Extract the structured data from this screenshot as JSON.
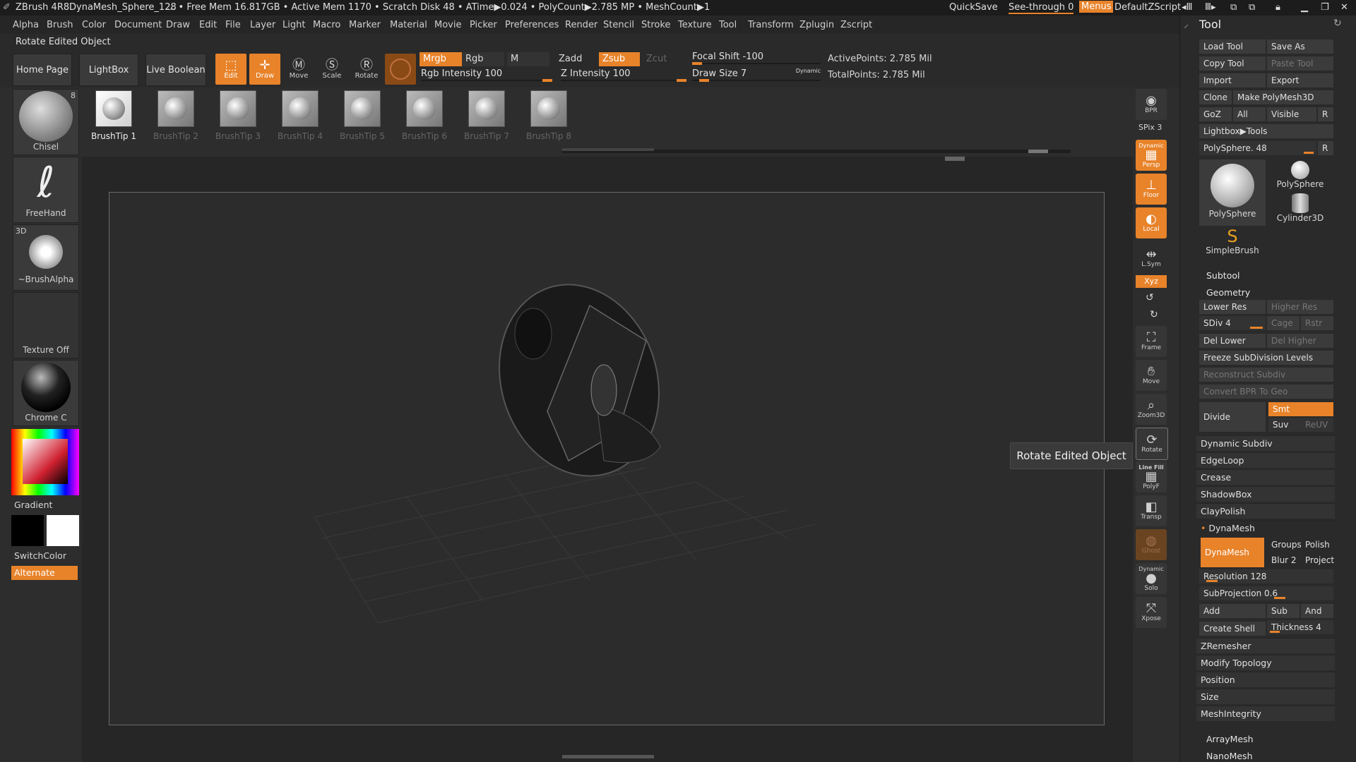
{
  "titlebar": {
    "app": "ZBrush 4R8",
    "doc": "DynaMesh_Sphere_128",
    "stats": "... • Free Mem 16.817GB • Active Mem 1170 • Scratch Disk 48 •  ATime▶0.024 • PolyCount▶2.785 MP  • MeshCount▶1",
    "quicksave": "QuickSave",
    "seethrough": "See-through   0",
    "menus": "Menus",
    "script": "DefaultZScript"
  },
  "menus": [
    "Alpha",
    "Brush",
    "Color",
    "Document",
    "Draw",
    "Edit",
    "File",
    "Layer",
    "Light",
    "Macro",
    "Marker",
    "Material",
    "Movie",
    "Picker",
    "Preferences",
    "Render",
    "Stencil",
    "Stroke",
    "Texture",
    "Tool",
    "Transform",
    "Zplugin",
    "Zscript"
  ],
  "status_text": "Rotate Edited Object",
  "toolbar": {
    "home": "Home Page",
    "lightbox": "LightBox",
    "liveboolean": "Live Boolean",
    "edit": "Edit",
    "draw": "Draw",
    "move": "Move",
    "scale": "Scale",
    "rotate": "Rotate",
    "mrgb": "Mrgb",
    "rgb": "Rgb",
    "m": "M",
    "zadd": "Zadd",
    "zsub": "Zsub",
    "zcut": "Zcut",
    "rgb_intensity": "Rgb Intensity 100",
    "z_intensity": "Z Intensity 100",
    "focal_shift": "Focal Shift -100",
    "draw_size": "Draw Size 7",
    "dynamic": "Dynamic",
    "active_points": "ActivePoints: 2.785 Mil",
    "total_points": "TotalPoints: 2.785 Mil"
  },
  "brushtips": [
    "BrushTip 1",
    "BrushTip 2",
    "BrushTip 3",
    "BrushTip 4",
    "BrushTip 5",
    "BrushTip 6",
    "BrushTip 7",
    "BrushTip 8"
  ],
  "left": {
    "brush": "Chisel",
    "brush_count": "8",
    "stroke": "FreeHand",
    "alpha_tag": "3D",
    "alpha": "~BrushAlpha",
    "texture": "Texture Off",
    "material": "Chrome C",
    "gradient": "Gradient",
    "switchcolor": "SwitchColor",
    "alternate": "Alternate"
  },
  "shelf": {
    "bpr": "BPR",
    "spix": "SPix 3",
    "dynamic": "Dynamic",
    "persp": "Persp",
    "floor": "Floor",
    "local": "Local",
    "lsym": "L.Sym",
    "xyz": "Xyz",
    "frame": "Frame",
    "move": "Move",
    "zoom": "Zoom3D",
    "rotate": "Rotate",
    "linefill": "Line Fill",
    "polyf": "PolyF",
    "transp": "Transp",
    "ghost": "Ghost",
    "dynamic2": "Dynamic",
    "solo": "Solo",
    "xpose": "Xpose"
  },
  "tooltip": "Rotate Edited Object",
  "tool": {
    "title": "Tool",
    "load": "Load Tool",
    "saveas": "Save As",
    "copy": "Copy Tool",
    "paste": "Paste Tool",
    "import": "Import",
    "export": "Export",
    "clone": "Clone",
    "make": "Make PolyMesh3D",
    "goz": "GoZ",
    "all": "All",
    "visible": "Visible",
    "r": "R",
    "lightbox": "Lightbox▶Tools",
    "polysphere_slider": "PolySphere. 48",
    "thumb1": "PolySphere",
    "thumb2": "PolySphere",
    "thumb3": "Cylinder3D",
    "thumb4": "SimpleBrush",
    "subtool": "Subtool",
    "geometry": "Geometry",
    "lower": "Lower Res",
    "higher": "Higher Res",
    "sdiv": "SDiv 4",
    "cage": "Cage",
    "rstr": "Rstr",
    "dellower": "Del Lower",
    "delhigher": "Del Higher",
    "freeze": "Freeze SubDivision Levels",
    "reconstruct": "Reconstruct Subdiv",
    "convert": "Convert BPR To Geo",
    "divide": "Divide",
    "smt": "Smt",
    "suv": "Suv",
    "reuv": "ReUV",
    "dynsubdiv": "Dynamic Subdiv",
    "edgeloop": "EdgeLoop",
    "crease": "Crease",
    "shadowbox": "ShadowBox",
    "claypolish": "ClayPolish",
    "dynamesh_head": "DynaMesh",
    "dynamesh_btn": "DynaMesh",
    "groups": "Groups",
    "polish": "Polish",
    "blur": "Blur 2",
    "project": "Project",
    "resolution": "Resolution 128",
    "subprojection": "SubProjection 0.6",
    "add": "Add",
    "sub": "Sub",
    "and": "And",
    "createshell": "Create Shell",
    "thickness": "Thickness 4",
    "zremesher": "ZRemesher",
    "modtopo": "Modify Topology",
    "position": "Position",
    "size": "Size",
    "meshintegrity": "MeshIntegrity",
    "arraymesh": "ArrayMesh",
    "nanomesh": "NanoMesh"
  },
  "colors": {
    "accent": "#e8832a",
    "bg": "#2d2d2d",
    "panel": "#3b3b3b"
  }
}
